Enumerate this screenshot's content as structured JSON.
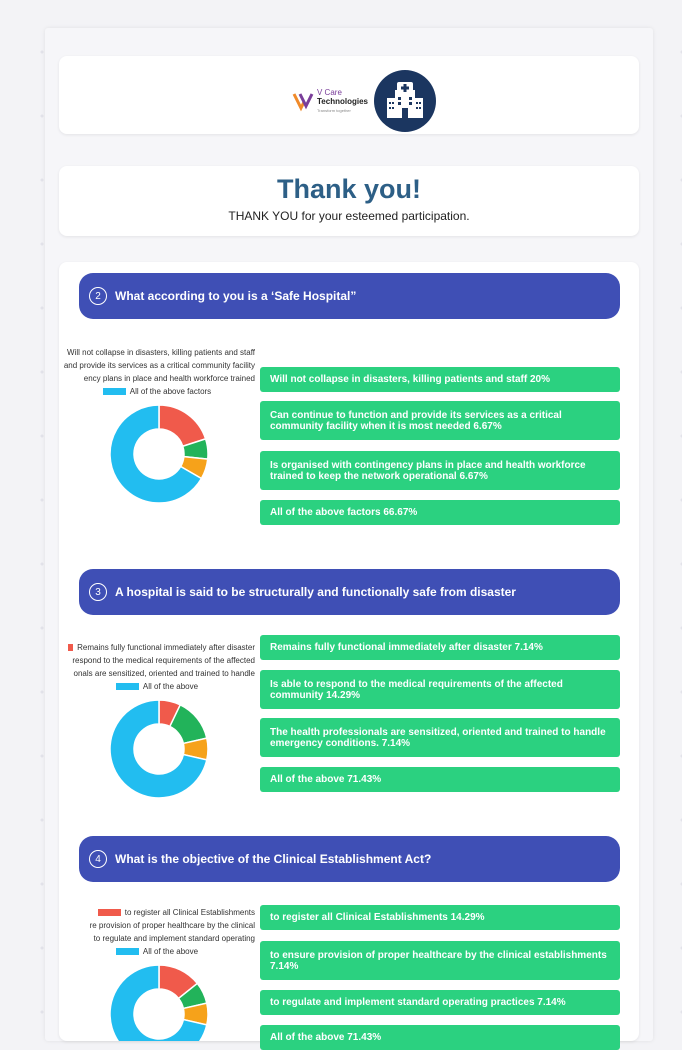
{
  "brand": {
    "line1": "V Care",
    "line2": "Technologies",
    "tagline": "Transform together"
  },
  "thank": {
    "title": "Thank you!",
    "subtitle": "THANK YOU for your esteemed participation."
  },
  "colors": {
    "red": "#f05a4b",
    "green": "#22b35a",
    "orange": "#f6a21a",
    "blue": "#22bdf0",
    "header": "#3f4fb5",
    "option": "#2bd180"
  },
  "questions": [
    {
      "number": "2",
      "title": "What according to you is a ‘Safe Hospital”",
      "legend": [
        "Will not collapse in disasters, killing patients and staff",
        "and provide its services as a critical community facility",
        "ency plans in place and health workforce trained",
        "All of the above factors"
      ],
      "options": [
        "Will not collapse in disasters, killing patients and staff 20%",
        "Can continue to function and provide its services as a critical community facility when it is most needed 6.67%",
        "Is organised with contingency plans in place and health workforce trained to keep the network operational 6.67%",
        "All of the above factors 66.67%"
      ]
    },
    {
      "number": "3",
      "title": "A hospital is said to be structurally and functionally safe from disaster",
      "legend": [
        "Remains fully functional immediately after disaster",
        "respond to the medical requirements of the affected",
        "onals are sensitized, oriented and trained to handle",
        "All of the above"
      ],
      "options": [
        "Remains fully functional immediately after disaster 7.14%",
        "Is able to respond to the medical requirements of the affected community 14.29%",
        "The health professionals are sensitized, oriented and trained to handle emergency conditions. 7.14%",
        "All of the above 71.43%"
      ]
    },
    {
      "number": "4",
      "title": "What is the objective of the Clinical Establishment Act?",
      "legend": [
        "to register all Clinical Establishments",
        "re provision of proper healthcare by the clinical",
        "to regulate and implement standard operating",
        "All of the above"
      ],
      "options": [
        "to register all Clinical Establishments 14.29%",
        "to ensure provision of proper healthcare by the clinical establishments 7.14%",
        "to regulate and implement standard operating practices 7.14%",
        "All of the above 71.43%"
      ]
    }
  ],
  "chart_data": [
    {
      "type": "pie",
      "categories": [
        "Will not collapse in disasters, killing patients and staff",
        "Can continue to function and provide its services as a critical community facility when it is most needed",
        "Is organised with contingency plans in place and health workforce trained to keep the network operational",
        "All of the above factors"
      ],
      "values": [
        20,
        6.67,
        6.67,
        66.67
      ]
    },
    {
      "type": "pie",
      "categories": [
        "Remains fully functional immediately after disaster",
        "Is able to respond to the medical requirements of the affected community",
        "The health professionals are sensitized, oriented and trained to handle emergency conditions.",
        "All of the above"
      ],
      "values": [
        7.14,
        14.29,
        7.14,
        71.43
      ]
    },
    {
      "type": "pie",
      "categories": [
        "to register all Clinical Establishments",
        "to ensure provision of proper healthcare by the clinical establishments",
        "to regulate and implement standard operating practices",
        "All of the above"
      ],
      "values": [
        14.29,
        7.14,
        7.14,
        71.43
      ]
    }
  ]
}
